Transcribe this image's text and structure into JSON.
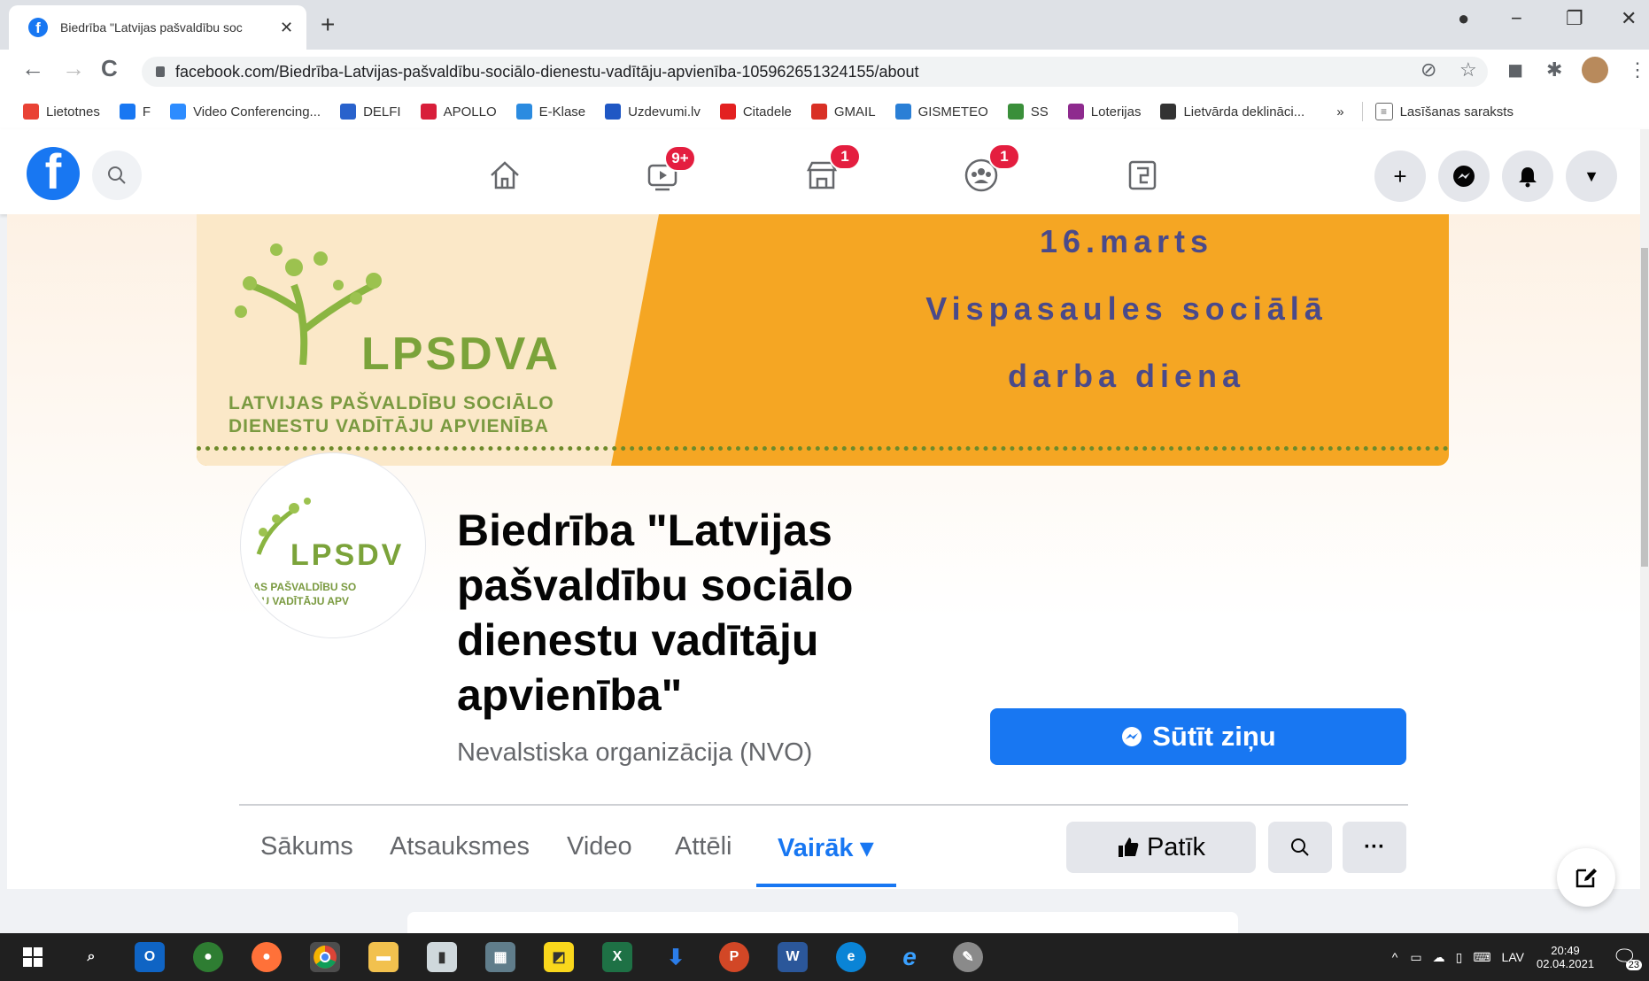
{
  "browser": {
    "tab_title": "Biedrība \"Latvijas pašvaldību soc",
    "tab_close": "✕",
    "new_tab": "+",
    "url": "facebook.com/Biedrība-Latvijas-pašvaldību-sociālo-dienestu-vadītāju-apvienība-105962651324155/about",
    "window_controls": {
      "record": "●",
      "minimize": "−",
      "restore": "❐",
      "close": "✕"
    },
    "nav": {
      "back": "←",
      "forward": "→",
      "reload": "C"
    },
    "toolbar_icons": {
      "eye_off": "⊘",
      "star": "☆",
      "ext": "◼",
      "puzzle": "✱",
      "menu": "⋮"
    }
  },
  "bookmarks": [
    {
      "label": "Lietotnes",
      "icon": "apps-icon",
      "color": "#e94235"
    },
    {
      "label": "F",
      "icon": "facebook-icon",
      "color": "#1877f2"
    },
    {
      "label": "Video Conferencing...",
      "icon": "video-icon",
      "color": "#2d8cff"
    },
    {
      "label": "DELFI",
      "icon": "delfi-icon",
      "color": "#2962cc"
    },
    {
      "label": "APOLLO",
      "icon": "apollo-icon",
      "color": "#d81e3a"
    },
    {
      "label": "E-Klase",
      "icon": "eklase-icon",
      "color": "#2b8be0"
    },
    {
      "label": "Uzdevumi.lv",
      "icon": "uzdevumi-icon",
      "color": "#1f57c4"
    },
    {
      "label": "Citadele",
      "icon": "citadele-icon",
      "color": "#e32020"
    },
    {
      "label": "GMAIL",
      "icon": "gmail-icon",
      "color": "#d93025"
    },
    {
      "label": "GISMETEO",
      "icon": "gismeteo-icon",
      "color": "#2a7fd6"
    },
    {
      "label": "SS",
      "icon": "ss-icon",
      "color": "#3a8f3a"
    },
    {
      "label": "Loterijas",
      "icon": "loterijas-icon",
      "color": "#8e2a8e"
    },
    {
      "label": "Lietvārda deklināci...",
      "icon": "decl-icon",
      "color": "#333333"
    }
  ],
  "bookmarks_more": "»",
  "reading_list": "Lasīšanas saraksts",
  "fb": {
    "badges": {
      "watch": "9+",
      "marketplace": "1",
      "groups": "1"
    },
    "right": {
      "create": "+",
      "messenger": "◉",
      "notifications": "🔔",
      "account": "▼"
    }
  },
  "cover": {
    "date": "16.marts",
    "line1": "Vispasaules sociālā",
    "line2": "darba diena",
    "logo_text": "LPSDVA",
    "logo_sub1": "LATVIJAS PAŠVALDĪBU SOCIĀLO",
    "logo_sub2": "DIENESTU VADĪTĀJU APVIENĪBA"
  },
  "profile": {
    "logo_text": "LPSDV",
    "logo_sub1": "IAS PAŠVALDĪBU SO",
    "logo_sub2": "TU VADĪTĀJU APV"
  },
  "page": {
    "name": "Biedrība \"Latvijas pašvaldību sociālo dienestu vadītāju apvienība\"",
    "category": "Nevalstiska organizācija (NVO)",
    "send_button": "Sūtīt ziņu"
  },
  "tabs": [
    "Sākums",
    "Atsauksmes",
    "Video",
    "Attēli"
  ],
  "tab_active": "Vairāk ▾",
  "actions": {
    "like": "Patīk",
    "search": "🔍",
    "more": "···"
  },
  "taskbar": {
    "lang": "LAV",
    "time": "20:49",
    "date": "02.04.2021",
    "notif_count": "23"
  },
  "colors": {
    "fb_blue": "#1877f2",
    "cover_orange": "#f5a623",
    "badge_red": "#e41e3f"
  }
}
